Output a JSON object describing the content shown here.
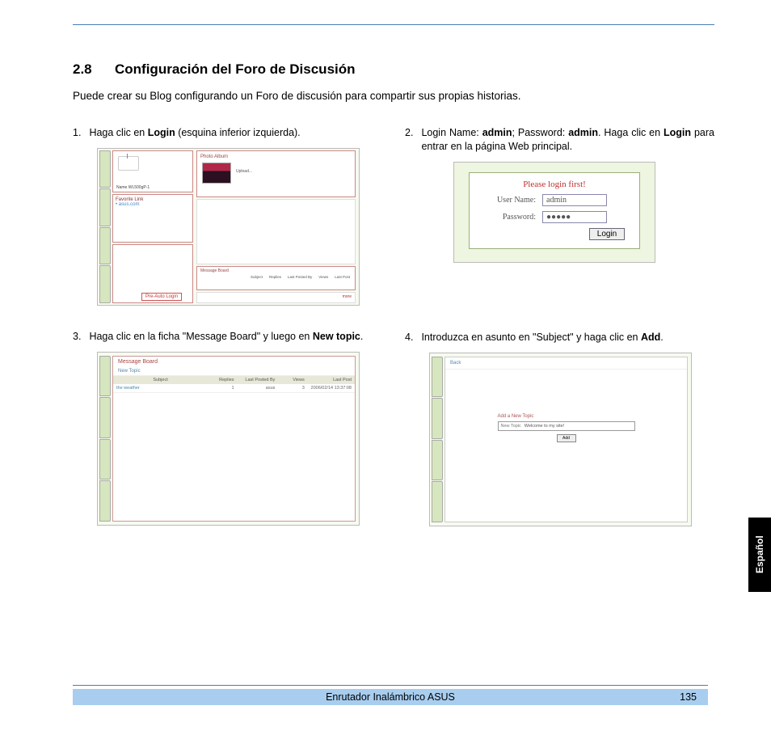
{
  "section": {
    "number": "2.8",
    "title": "Configuración del Foro de Discusión"
  },
  "intro": "Puede crear su Blog configurando un Foro de discusión para compartir sus propias historias.",
  "steps": {
    "s1": {
      "num": "1.",
      "pre": "Haga clic en ",
      "b": "Login",
      "post": " (esquina inferior izquierda)."
    },
    "s2": {
      "num": "2.",
      "pre": "Login Name: ",
      "b1": "admin",
      "mid": "; Password: ",
      "b2": "admin",
      "mid2": ". Haga clic en ",
      "b3": "Login",
      "post": " para entrar en la página Web principal."
    },
    "s3": {
      "num": "3.",
      "pre": "Haga clic en la ficha \"Message Board\" y luego en ",
      "b": "New topic",
      "post": "."
    },
    "s4": {
      "num": "4.",
      "text": "Introduzca en asunto en \"Subject\" y haga clic en ",
      "b": "Add",
      "post": "."
    }
  },
  "fig1": {
    "album_label": "Photo Album",
    "upload_label": "Upload...",
    "device_name": "Name   WL500gP-1",
    "more": "more",
    "favorites": "Favorite Link",
    "fav_item": "• asus.com",
    "mb_title": "Message Board",
    "mb_cols": [
      "Subject",
      "Replies",
      "Last Posted By",
      "Views",
      "Last Post"
    ],
    "login_btn": "Pre-Auto Login"
  },
  "fig2": {
    "title": "Please login first!",
    "user_label": "User Name:",
    "user_value": "admin",
    "pass_label": "Password:",
    "pass_value": "●●●●●",
    "login_btn": "Login"
  },
  "fig3": {
    "title": "Message Board",
    "new_topic": "New Topic",
    "cols": [
      "Subject",
      "Replies",
      "Last Posted By",
      "Views",
      "Last Post"
    ],
    "row": [
      "the weather",
      "1",
      "asus",
      "3",
      "2006/02/14 13:37:08"
    ]
  },
  "fig4": {
    "back": "Back",
    "heading": "Add a New Topic",
    "field_label": "New Topic",
    "field_value": "Welcome to my site!",
    "add_btn": "Add"
  },
  "lang_tab": "Español",
  "footer": {
    "title": "Enrutador Inalámbrico ASUS",
    "page": "135"
  }
}
